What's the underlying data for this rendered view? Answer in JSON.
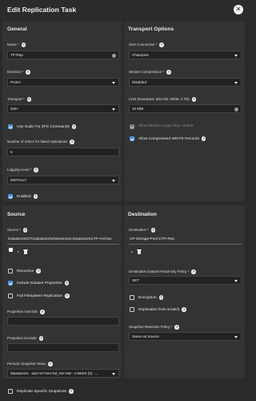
{
  "dialog": {
    "title": "Edit Replication Task",
    "close_icon": "close-icon"
  },
  "general": {
    "heading": "General",
    "name": {
      "label": "Name *",
      "value": "TP-Rep"
    },
    "direction": {
      "label": "Direction *",
      "value": "PUSH"
    },
    "transport": {
      "label": "Transport *",
      "value": "SSH"
    },
    "use_sudo": {
      "label": "Use Sudo For ZFS Commands",
      "checked": true
    },
    "retries": {
      "label": "Number of retries for failed replications",
      "value": "5"
    },
    "logging_level": {
      "label": "Logging Level *",
      "value": "DEFAULT"
    },
    "enabled": {
      "label": "Enabled",
      "checked": true
    }
  },
  "transport_options": {
    "heading": "Transport Options",
    "ssh_connection": {
      "label": "SSH Connection *",
      "value": "Champion"
    },
    "stream_compression": {
      "label": "Stream Compression *",
      "value": "Disabled"
    },
    "limit": {
      "label": "Limit (Examples: 500 KiB, 500M, 2 TB)",
      "value": "10 MiB"
    },
    "allow_blocks_larger": {
      "label": "Allow Blocks Larger than 128KB",
      "checked": true,
      "disabled": true
    },
    "allow_compressed": {
      "label": "Allow Compressed WRITE Records",
      "checked": true
    }
  },
  "source": {
    "heading": "Source",
    "source_field": {
      "label": "Source *",
      "value": "Datastore01/IT,Datastore01/Newsroom,Datastore01/TP-Archive"
    },
    "recursive": {
      "label": "Recursive",
      "checked": false
    },
    "include_dataset_properties": {
      "label": "Include Dataset Properties",
      "checked": true
    },
    "full_filesystem_replication": {
      "label": "Full Filesystem Replication",
      "checked": false
    },
    "properties_override": {
      "label": "Properties Override",
      "value": ""
    },
    "properties_exclude": {
      "label": "Properties Exclude",
      "value": ""
    },
    "periodic_snapshot_tasks": {
      "label": "Periodic Snapshot Tasks",
      "value": "Datastore01 - auto-%Y-%m-%d_%H-%M - 2 WEEK (S) - ..."
    },
    "replicate_specific_snapshots": {
      "label": "Replicate Specific Snapshots",
      "checked": false
    }
  },
  "destination": {
    "heading": "Destination",
    "destination_field": {
      "label": "Destination *",
      "value": "CP-Storage-Pool-1/TP-Rep"
    },
    "read_only_policy": {
      "label": "Destination Dataset Read-only Policy *",
      "value": "SET"
    },
    "encryption": {
      "label": "Encryption",
      "checked": false
    },
    "replication_from_scratch": {
      "label": "Replication from scratch",
      "checked": false
    },
    "snapshot_retention_policy": {
      "label": "Snapshot Retention Policy *",
      "value": "Same as Source"
    }
  },
  "colors": {
    "accent": "#4a90d9",
    "background": "#2a2a2a",
    "panel": "#333333"
  }
}
